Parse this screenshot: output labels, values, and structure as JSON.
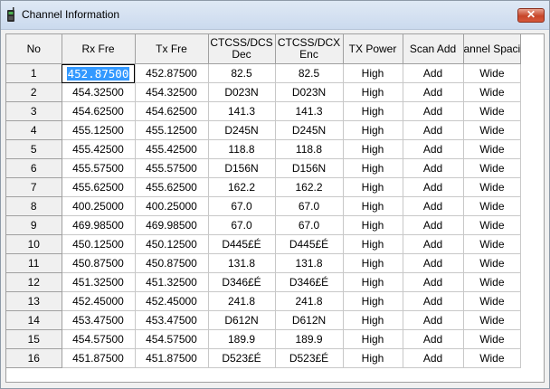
{
  "window": {
    "title": "Channel Information",
    "close_symbol": "✕"
  },
  "columns": [
    "No",
    "Rx Fre",
    "Tx Fre",
    "CTCSS/DCS Dec",
    "CTCSS/DCX Enc",
    "TX Power",
    "Scan Add",
    "annel Spaci"
  ],
  "column_headers": [
    {
      "l1": "No",
      "l2": ""
    },
    {
      "l1": "Rx Fre",
      "l2": ""
    },
    {
      "l1": "Tx Fre",
      "l2": ""
    },
    {
      "l1": "CTCSS/DCS",
      "l2": "Dec"
    },
    {
      "l1": "CTCSS/DCX",
      "l2": "Enc"
    },
    {
      "l1": "TX Power",
      "l2": ""
    },
    {
      "l1": "Scan Add",
      "l2": ""
    },
    {
      "l1": "annel Spaci",
      "l2": ""
    }
  ],
  "editing_value": "452.87500",
  "rows": [
    [
      "1",
      "452.87500",
      "452.87500",
      "82.5",
      "82.5",
      "High",
      "Add",
      "Wide"
    ],
    [
      "2",
      "454.32500",
      "454.32500",
      "D023N",
      "D023N",
      "High",
      "Add",
      "Wide"
    ],
    [
      "3",
      "454.62500",
      "454.62500",
      "141.3",
      "141.3",
      "High",
      "Add",
      "Wide"
    ],
    [
      "4",
      "455.12500",
      "455.12500",
      "D245N",
      "D245N",
      "High",
      "Add",
      "Wide"
    ],
    [
      "5",
      "455.42500",
      "455.42500",
      "118.8",
      "118.8",
      "High",
      "Add",
      "Wide"
    ],
    [
      "6",
      "455.57500",
      "455.57500",
      "D156N",
      "D156N",
      "High",
      "Add",
      "Wide"
    ],
    [
      "7",
      "455.62500",
      "455.62500",
      "162.2",
      "162.2",
      "High",
      "Add",
      "Wide"
    ],
    [
      "8",
      "400.25000",
      "400.25000",
      "67.0",
      "67.0",
      "High",
      "Add",
      "Wide"
    ],
    [
      "9",
      "469.98500",
      "469.98500",
      "67.0",
      "67.0",
      "High",
      "Add",
      "Wide"
    ],
    [
      "10",
      "450.12500",
      "450.12500",
      "D445£É",
      "D445£É",
      "High",
      "Add",
      "Wide"
    ],
    [
      "11",
      "450.87500",
      "450.87500",
      "131.8",
      "131.8",
      "High",
      "Add",
      "Wide"
    ],
    [
      "12",
      "451.32500",
      "451.32500",
      "D346£É",
      "D346£É",
      "High",
      "Add",
      "Wide"
    ],
    [
      "13",
      "452.45000",
      "452.45000",
      "241.8",
      "241.8",
      "High",
      "Add",
      "Wide"
    ],
    [
      "14",
      "453.47500",
      "453.47500",
      "D612N",
      "D612N",
      "High",
      "Add",
      "Wide"
    ],
    [
      "15",
      "454.57500",
      "454.57500",
      "189.9",
      "189.9",
      "High",
      "Add",
      "Wide"
    ],
    [
      "16",
      "451.87500",
      "451.87500",
      "D523£É",
      "D523£É",
      "High",
      "Add",
      "Wide"
    ]
  ]
}
